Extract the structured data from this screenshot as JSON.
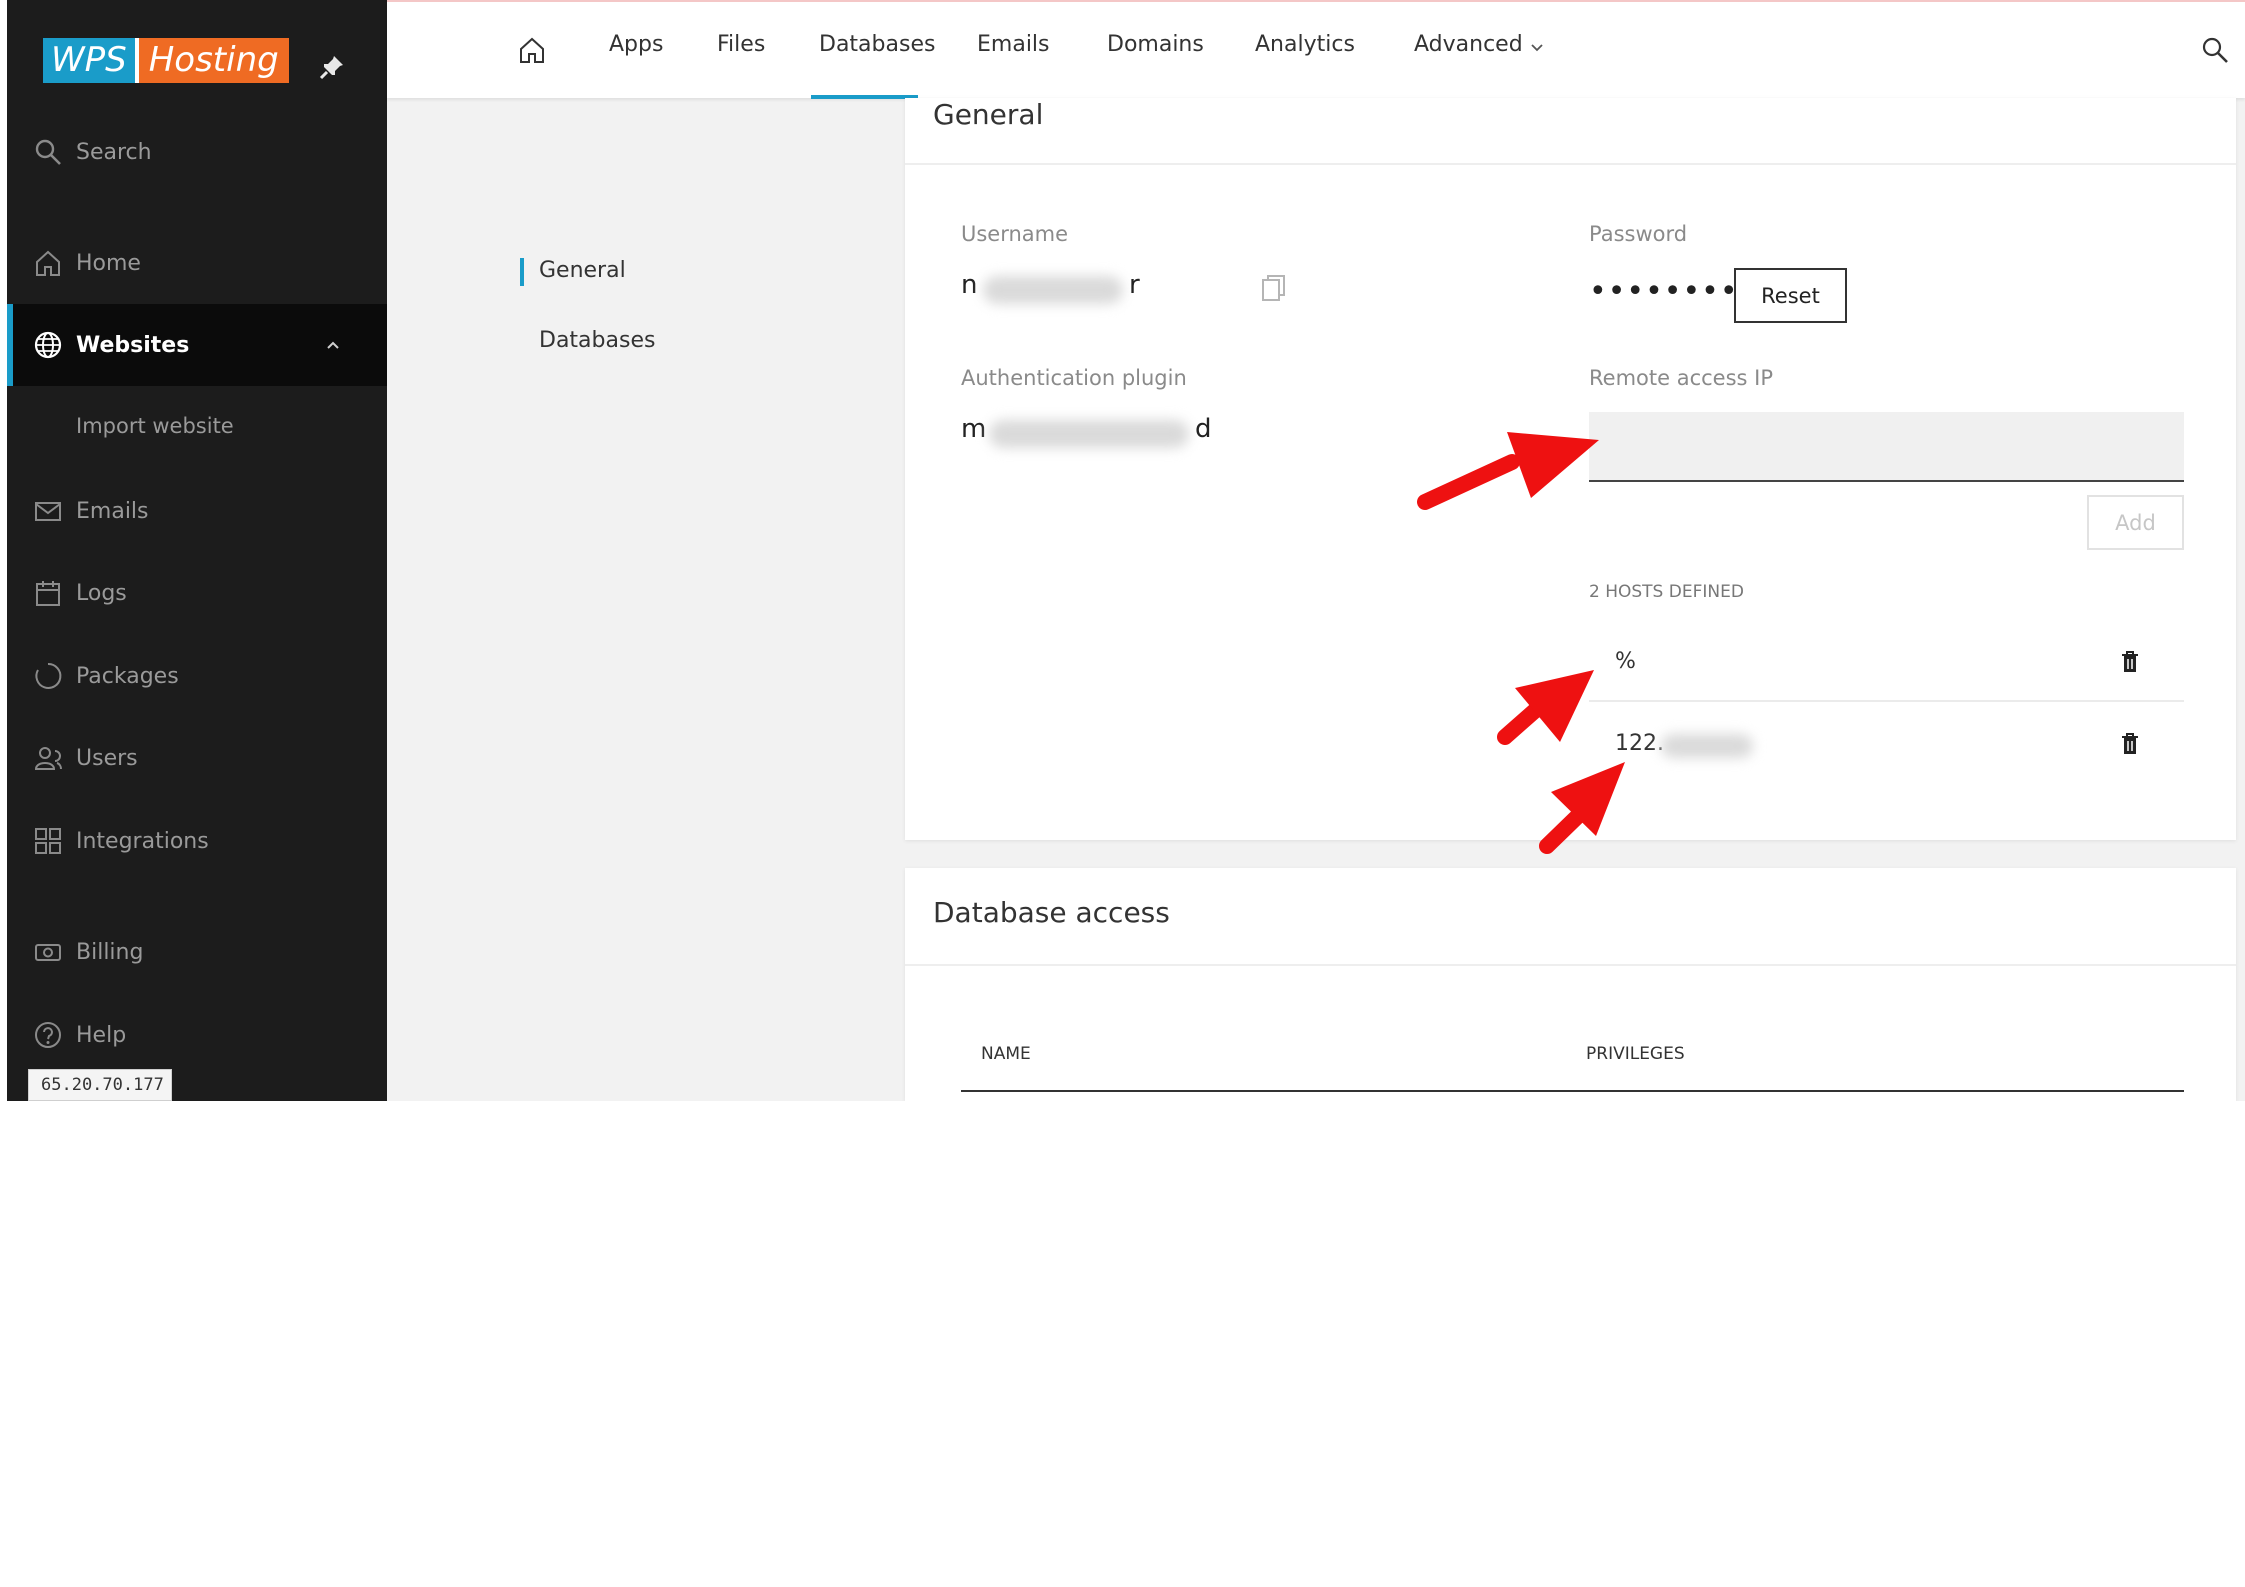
{
  "brand": {
    "left": "WPS",
    "right": "Hosting"
  },
  "sidebar": {
    "search_label": "Search",
    "items": [
      {
        "label": "Home",
        "icon": "home-icon"
      },
      {
        "label": "Websites",
        "icon": "globe-icon",
        "active": true
      },
      {
        "label": "Import website"
      },
      {
        "label": "Emails",
        "icon": "mail-icon"
      },
      {
        "label": "Logs",
        "icon": "calendar-icon"
      },
      {
        "label": "Packages",
        "icon": "circle-icon"
      },
      {
        "label": "Users",
        "icon": "users-icon"
      },
      {
        "label": "Integrations",
        "icon": "grid-icon"
      },
      {
        "label": "Billing",
        "icon": "billing-icon"
      },
      {
        "label": "Help",
        "icon": "help-icon"
      }
    ],
    "ip_badge": "65.20.70.177"
  },
  "topnav": {
    "links": [
      "Apps",
      "Files",
      "Databases",
      "Emails",
      "Domains",
      "Analytics",
      "Advanced"
    ],
    "active": "Databases"
  },
  "subnav": {
    "items": [
      "General",
      "Databases"
    ],
    "active": "General"
  },
  "general": {
    "title": "General",
    "username_label": "Username",
    "username_prefix": "n",
    "username_suffix": "r",
    "password_label": "Password",
    "password_mask": "••••••••••",
    "reset_label": "Reset",
    "auth_label": "Authentication plugin",
    "auth_prefix": "m",
    "auth_suffix": "d",
    "remote_label": "Remote access IP",
    "remote_value": "",
    "add_label": "Add",
    "hosts_label": "2 HOSTS DEFINED",
    "hosts": [
      "%",
      "122."
    ]
  },
  "db_access": {
    "title": "Database access",
    "columns": [
      "NAME",
      "PRIVILEGES"
    ]
  },
  "colors": {
    "accent": "#1a9cc9",
    "brand_orange": "#ef6b23",
    "sidebar_bg": "#1c1c1c",
    "arrow": "#ee1111"
  }
}
